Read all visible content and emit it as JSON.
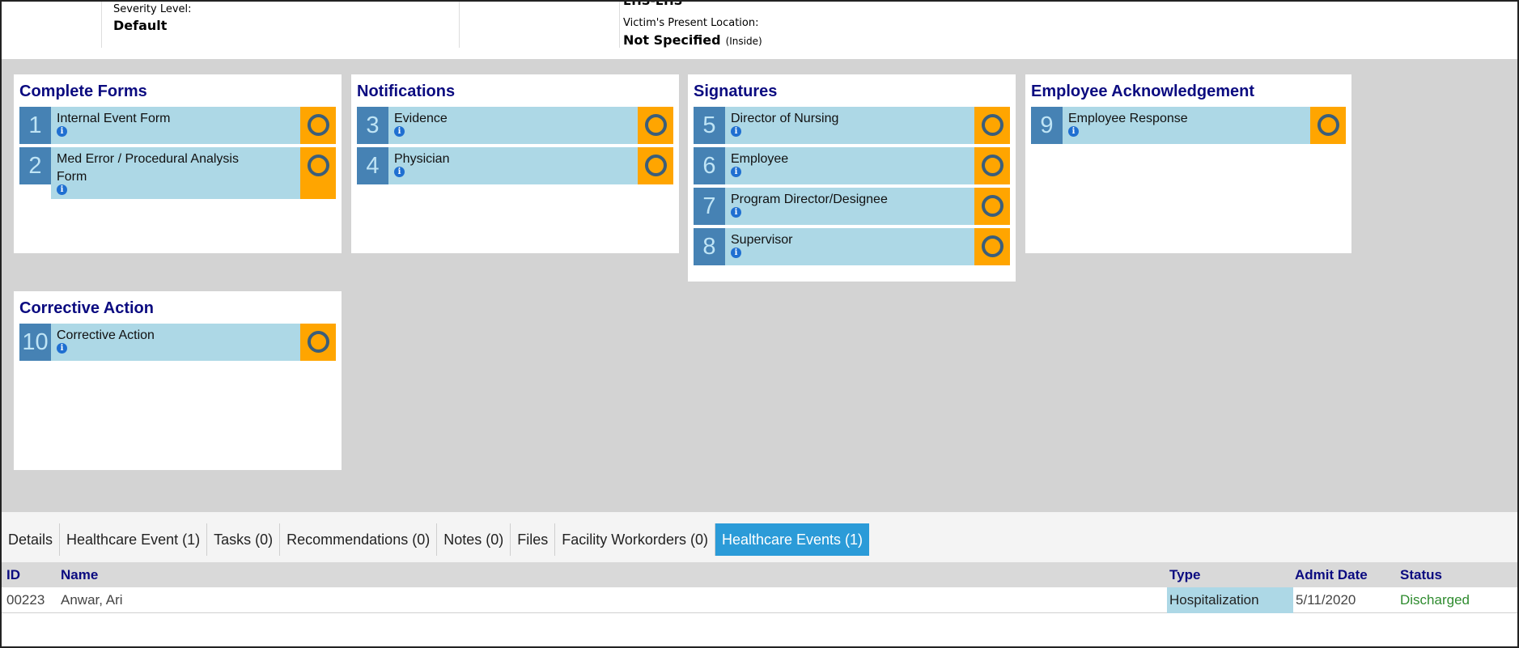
{
  "header": {
    "severity_label": "Severity Level:",
    "severity_value": "Default",
    "clipped_value": "EHS-EHS",
    "victim_location_label": "Victim's Present Location:",
    "victim_location_value": "Not Specified",
    "victim_location_sub": "(Inside)"
  },
  "cards": [
    {
      "title": "Complete Forms",
      "steps": [
        {
          "num": "1",
          "label": "Internal Event Form"
        },
        {
          "num": "2",
          "label": "Med Error / Procedural Analysis Form"
        }
      ]
    },
    {
      "title": "Notifications",
      "steps": [
        {
          "num": "3",
          "label": "Evidence"
        },
        {
          "num": "4",
          "label": "Physician"
        }
      ]
    },
    {
      "title": "Signatures",
      "steps": [
        {
          "num": "5",
          "label": "Director of Nursing"
        },
        {
          "num": "6",
          "label": "Employee"
        },
        {
          "num": "7",
          "label": "Program Director/Designee"
        },
        {
          "num": "8",
          "label": "Supervisor"
        }
      ]
    },
    {
      "title": "Employee Acknowledgement",
      "steps": [
        {
          "num": "9",
          "label": "Employee Response"
        }
      ]
    },
    {
      "title": "Corrective Action",
      "steps": [
        {
          "num": "10",
          "label": "Corrective Action"
        }
      ]
    }
  ],
  "icons": {
    "info": "info-icon",
    "status": "pending-ring-icon"
  },
  "tabs": [
    {
      "label": "Details"
    },
    {
      "label": "Healthcare Event (1)"
    },
    {
      "label": "Tasks (0)"
    },
    {
      "label": "Recommendations (0)"
    },
    {
      "label": "Notes (0)"
    },
    {
      "label": "Files"
    },
    {
      "label": "Facility Workorders (0)"
    },
    {
      "label": "Healthcare Events (1)",
      "active": true
    }
  ],
  "table": {
    "columns": [
      "ID",
      "Name",
      "Type",
      "Admit Date",
      "Status"
    ],
    "rows": [
      {
        "id": "00223",
        "name": "Anwar, Ari",
        "type": "Hospitalization",
        "admit_date": "5/11/2020",
        "status": "Discharged"
      }
    ]
  },
  "colors": {
    "title": "#0b0b80",
    "step_number_bg": "#4682b4",
    "step_body_bg": "#add8e6",
    "status_bg": "#ffa500",
    "active_tab": "#2b9bd8",
    "discharged": "#2e8b2e"
  }
}
